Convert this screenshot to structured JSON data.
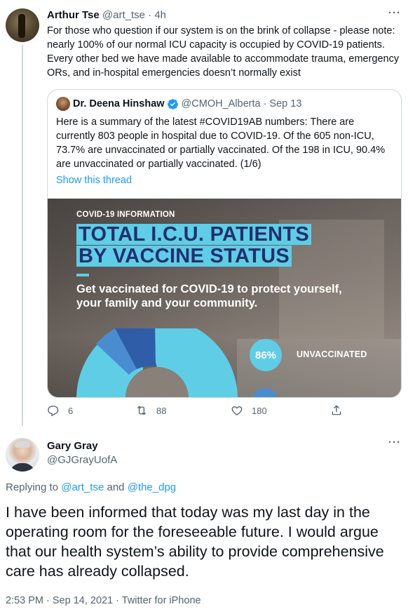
{
  "tweet1": {
    "author_name": "Arthur Tse",
    "author_handle": "@art_tse",
    "separator": "·",
    "time": "4h",
    "more_label": "···",
    "text": "For those who question if our system is on the brink of collapse - please note: nearly 100% of our normal ICU capacity is occupied by COVID-19 patients. Every other bed we have made available to accommodate trauma, emergency ORs, and in-hospital emergencies doesn’t normally exist",
    "quoted": {
      "author_name": "Dr. Deena Hinshaw",
      "author_handle": "@CMOH_Alberta",
      "separator": "·",
      "date": "Sep 13",
      "text": "Here is a summary of the latest #COVID19AB numbers: There are currently 803 people in hospital due to COVID-19. Of the 605 non-ICU, 73.7% are unvaccinated or partially vaccinated. Of the 198 in ICU, 90.4% are unvaccinated or partially vaccinated. (1/6)",
      "show_thread": "Show this thread",
      "infographic": {
        "label": "COVID-19 INFORMATION",
        "title_line1": "TOTAL I.C.U. PATIENTS",
        "title_line2": "BY VACCINE STATUS",
        "subtitle": "Get vaccinated for COVID-19 to protect yourself, your family and your community.",
        "percent": "86%",
        "percent_label": "UNVACCINATED",
        "colors": {
          "accent": "#5fcde6",
          "title_text": "#23306b",
          "mid_blue": "#4a8cd0",
          "dark_blue": "#2f5da8"
        }
      }
    },
    "actions": {
      "replies": "6",
      "retweets": "88",
      "likes": "180"
    }
  },
  "tweet2": {
    "author_name": "Gary Gray",
    "author_handle": "@GJGrayUofA",
    "more_label": "···",
    "replying_prefix": "Replying to",
    "replying_user1": "@art_tse",
    "replying_and": "and",
    "replying_user2": "@the_dpg",
    "text": "I have been informed that today was my last day in the operating room for the foreseeable future. I would argue that our health system’s ability to provide comprehensive care has already collapsed.",
    "timestamp": "2:53 PM · Sep 14, 2021 · Twitter for iPhone"
  },
  "colors": {
    "link_blue": "#1d9bf0",
    "secondary_text": "#536471",
    "primary_text": "#0f1419",
    "border": "#cfd9de"
  }
}
